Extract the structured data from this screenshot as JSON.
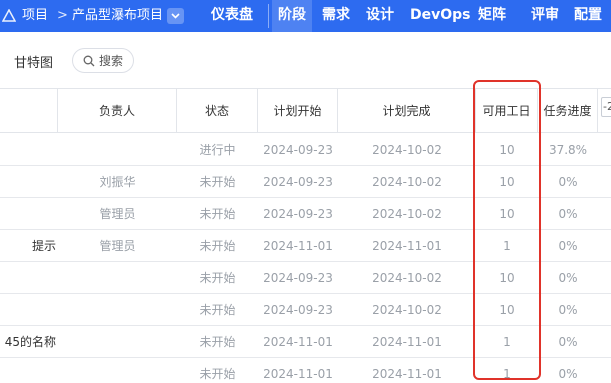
{
  "nav": {
    "breadcrumb_root": "项目",
    "breadcrumb_sep": ">",
    "project_name": "产品型瀑布项目",
    "items": [
      {
        "label": "仪表盘",
        "active": false
      },
      {
        "label": "阶段",
        "active": true
      },
      {
        "label": "需求",
        "active": false
      },
      {
        "label": "设计",
        "active": false
      },
      {
        "label": "DevOps",
        "active": false
      },
      {
        "label": "矩阵",
        "active": false
      },
      {
        "label": "评审",
        "active": false
      },
      {
        "label": "配置",
        "active": false
      }
    ]
  },
  "toolbar": {
    "gantt_label": "甘特图",
    "search_label": "搜索"
  },
  "table": {
    "columns": {
      "owner": "负责人",
      "status": "状态",
      "plan_start": "计划开始",
      "plan_end": "计划完成",
      "workdays": "可用工日",
      "progress": "任务进度",
      "extra": "-2"
    },
    "rows": [
      {
        "name": "",
        "owner": "",
        "status": "进行中",
        "start": "2024-09-23",
        "end": "2024-10-02",
        "workdays": "10",
        "progress": "37.8%"
      },
      {
        "name": "",
        "owner": "刘振华",
        "status": "未开始",
        "start": "2024-09-23",
        "end": "2024-10-02",
        "workdays": "10",
        "progress": "0%"
      },
      {
        "name": "",
        "owner": "管理员",
        "status": "未开始",
        "start": "2024-09-23",
        "end": "2024-10-02",
        "workdays": "10",
        "progress": "0%"
      },
      {
        "name": "提示",
        "owner": "管理员",
        "status": "未开始",
        "start": "2024-11-01",
        "end": "2024-11-01",
        "workdays": "1",
        "progress": "0%"
      },
      {
        "name": "",
        "owner": "",
        "status": "未开始",
        "start": "2024-09-23",
        "end": "2024-10-02",
        "workdays": "10",
        "progress": "0%"
      },
      {
        "name": "",
        "owner": "",
        "status": "未开始",
        "start": "2024-09-23",
        "end": "2024-10-02",
        "workdays": "10",
        "progress": "0%"
      },
      {
        "name": "45的名称",
        "owner": "",
        "status": "未开始",
        "start": "2024-11-01",
        "end": "2024-11-01",
        "workdays": "1",
        "progress": "0%"
      },
      {
        "name": "",
        "owner": "",
        "status": "未开始",
        "start": "2024-11-01",
        "end": "2024-11-01",
        "workdays": "1",
        "progress": "0%"
      }
    ]
  },
  "colors": {
    "nav_bg": "#2d6bf0",
    "highlight": "#e0332a"
  }
}
